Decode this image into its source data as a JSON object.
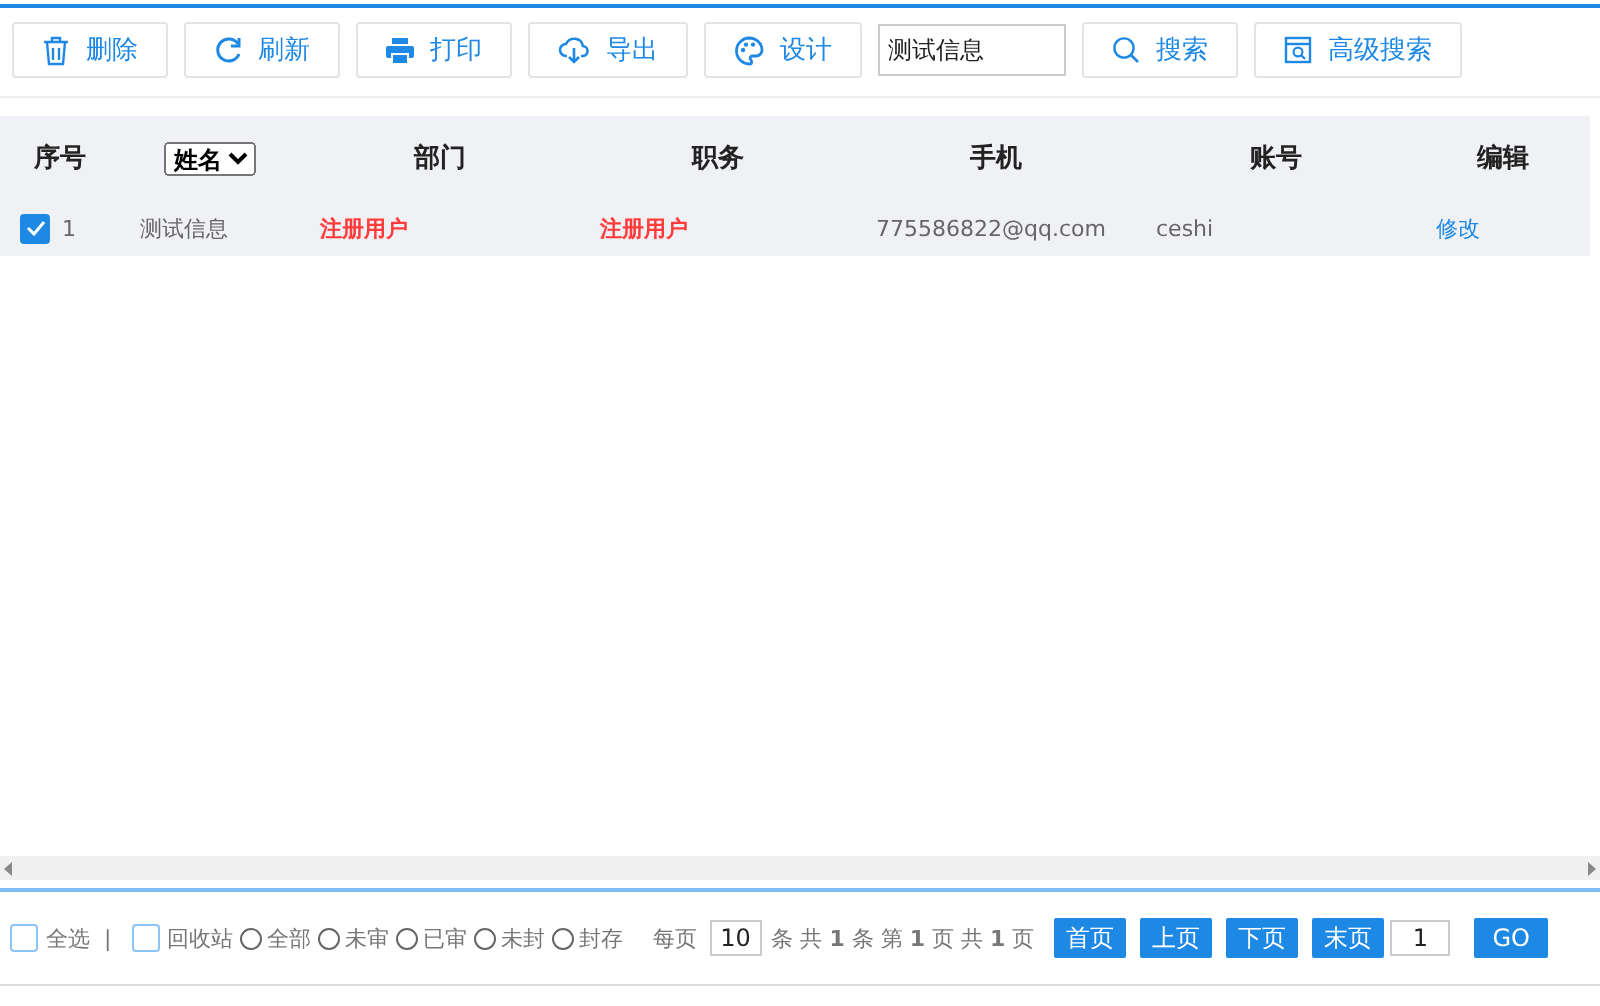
{
  "toolbar": {
    "buttons": [
      {
        "kind": "delete",
        "label": "删除"
      },
      {
        "kind": "refresh",
        "label": "刷新"
      },
      {
        "kind": "print",
        "label": "打印"
      },
      {
        "kind": "export",
        "label": "导出"
      },
      {
        "kind": "design",
        "label": "设计"
      }
    ],
    "search_value": "测试信息",
    "search_buttons": [
      {
        "kind": "search",
        "label": "搜索"
      },
      {
        "kind": "advanced",
        "label": "高级搜索"
      }
    ]
  },
  "table": {
    "columns": [
      {
        "kind": "text",
        "label": "序号"
      },
      {
        "kind": "select",
        "label": "姓名"
      },
      {
        "kind": "text",
        "label": "部门"
      },
      {
        "kind": "text",
        "label": "职务"
      },
      {
        "kind": "text",
        "label": "手机"
      },
      {
        "kind": "text",
        "label": "账号"
      },
      {
        "kind": "text",
        "label": "编辑"
      }
    ],
    "rows": [
      {
        "checked": true,
        "index": "1",
        "name": "测试信息",
        "department": "注册用户",
        "position": "注册用户",
        "phone": "775586822@qq.com",
        "account": "ceshi",
        "action": "修改"
      }
    ]
  },
  "footer": {
    "select_all": {
      "label": "全选",
      "checked": false
    },
    "separator": "|",
    "recycle": {
      "label": "回收站",
      "checked": false
    },
    "filters": [
      {
        "label": "全部",
        "selected": false
      },
      {
        "label": "未审",
        "selected": false
      },
      {
        "label": "已审",
        "selected": false
      },
      {
        "label": "未封",
        "selected": false
      },
      {
        "label": "封存",
        "selected": false
      }
    ],
    "per_page_label": "每页",
    "per_page": "10",
    "summary": "条 共 **1** 条 第 **1** 页 共 **1** 页",
    "pager_buttons": [
      "首页",
      "上页",
      "下页",
      "末页"
    ],
    "page_input": "1",
    "go": "GO"
  }
}
